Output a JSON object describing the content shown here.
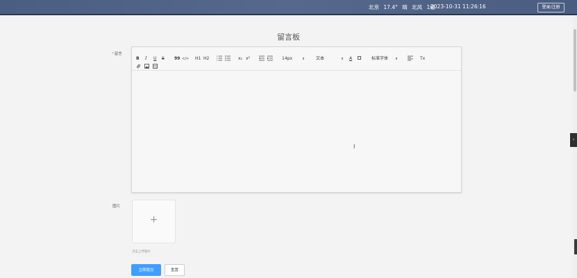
{
  "header": {
    "weather": {
      "city": "北京",
      "temperature": "17.4°",
      "condition": "晴",
      "wind": "北风",
      "wind_level": "1级"
    },
    "datetime": "2023-10-31 11:26:16",
    "login_register": "登录/注册"
  },
  "page": {
    "title": "留言板"
  },
  "form": {
    "message_label": "留言",
    "image_label": "图片",
    "upload_hint": "点击上传图片",
    "submit": "立即提交",
    "reset": "重置"
  },
  "editor": {
    "toolbar": {
      "bold": "B",
      "italic": "I",
      "underline": "U",
      "strike": "S",
      "blockquote": "99",
      "code": "</>",
      "h1": "H1",
      "h2": "H2",
      "font_size": "14px",
      "header_select": "文本",
      "font_family": "标准字体",
      "subscript": "x₂",
      "superscript": "x²",
      "color": "A",
      "clean": "Tx"
    },
    "icons": [
      "bold-icon",
      "italic-icon",
      "underline-icon",
      "strike-icon",
      "blockquote-icon",
      "code-icon",
      "header1-icon",
      "header2-icon",
      "ordered-list-icon",
      "bullet-list-icon",
      "subscript-icon",
      "superscript-icon",
      "outdent-icon",
      "indent-icon",
      "font-color-icon",
      "background-color-icon",
      "align-icon",
      "clean-format-icon",
      "link-icon",
      "image-icon",
      "video-icon"
    ]
  }
}
